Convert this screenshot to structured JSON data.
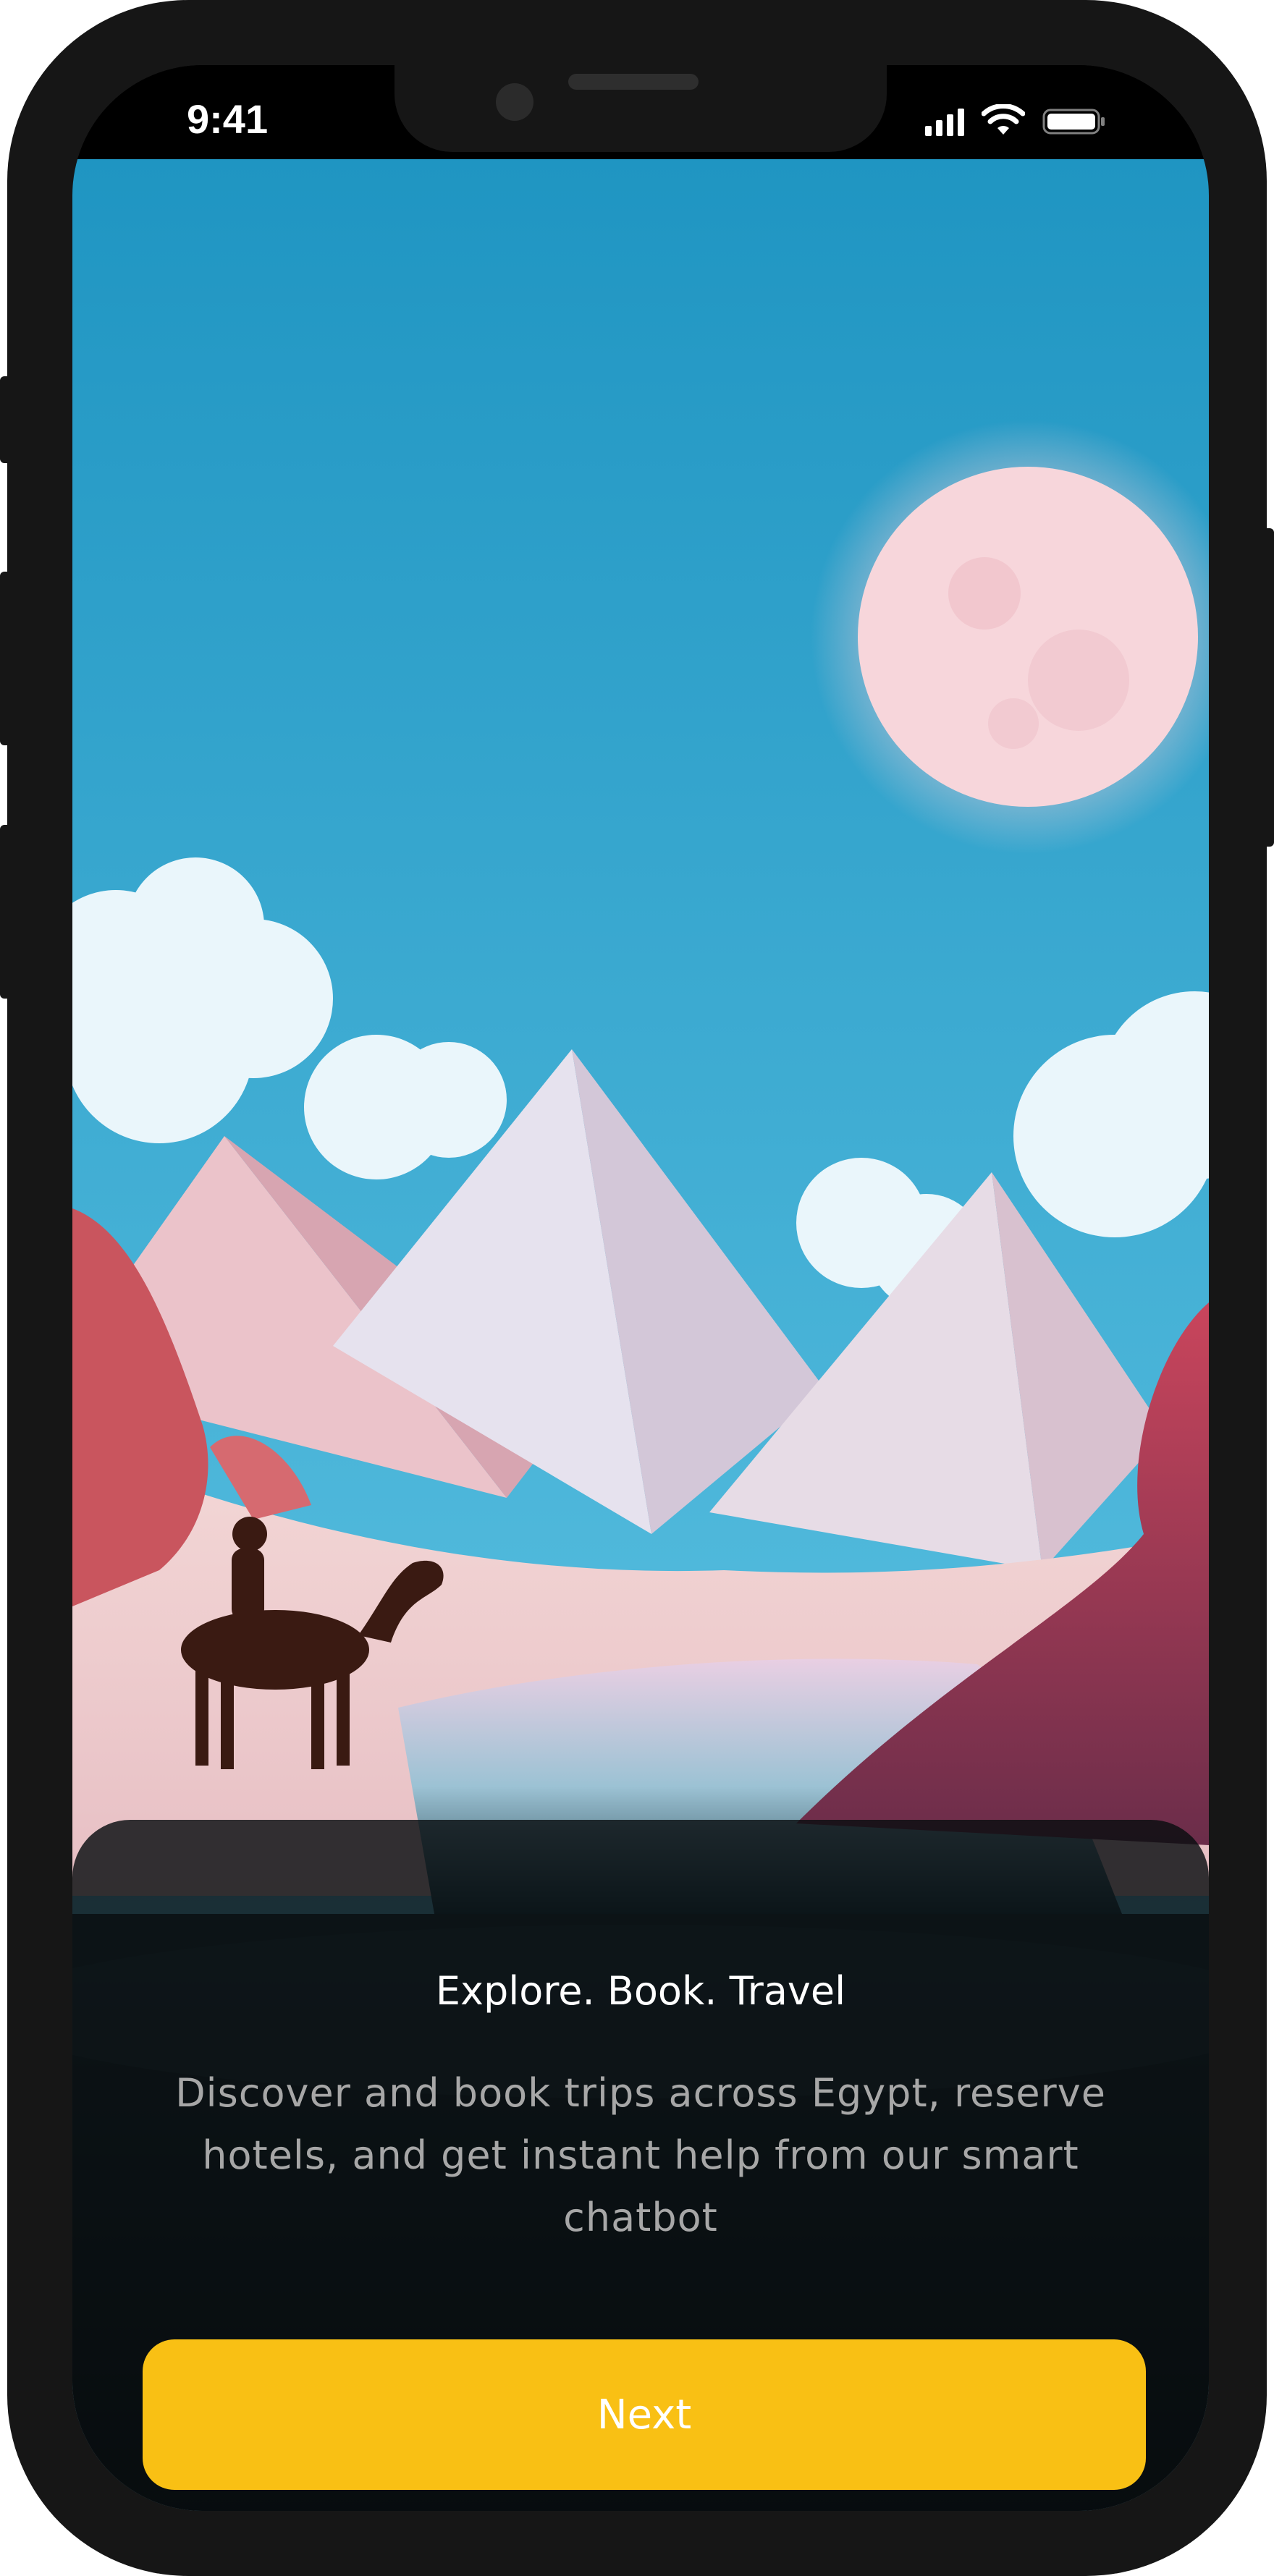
{
  "status_bar": {
    "time": "9:41",
    "icons": [
      "signal-icon",
      "wifi-icon",
      "battery-icon"
    ]
  },
  "hero": {
    "image": "pyramids-desert-camel-illustration"
  },
  "onboarding": {
    "title": "Explore. Book. Travel",
    "description": "Discover and book trips across Egypt, reserve hotels, and get instant help from our smart chatbot",
    "next_label": "Next"
  },
  "colors": {
    "accent": "#F9C014",
    "card_background": "#080E10",
    "sky_top": "#1F95C2",
    "sky_bottom": "#8FD6EE",
    "moon": "#F8D9DD"
  }
}
